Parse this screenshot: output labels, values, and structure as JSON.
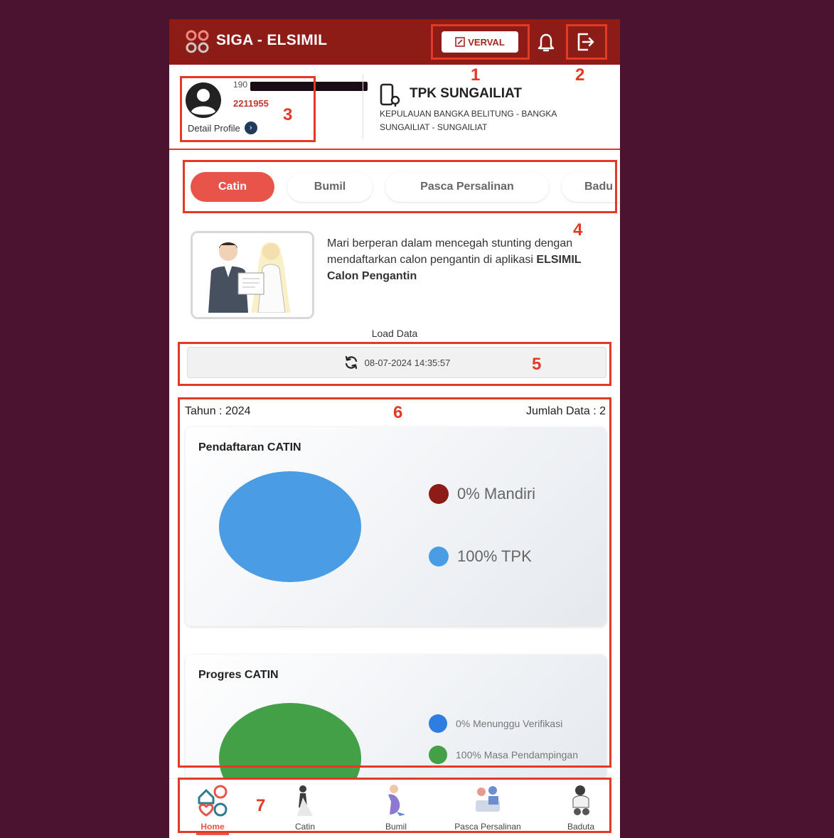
{
  "app": {
    "title": "SIGA - ELSIMIL",
    "verval_label": "VERVAL"
  },
  "profile": {
    "nik_prefix": "190",
    "kk_number": "2211955",
    "detail_label": "Detail Profile",
    "detail_arrow": "›"
  },
  "location": {
    "name": "TPK SUNGAILIAT",
    "address_line1": "KEPULAUAN BANGKA BELITUNG - BANGKA",
    "address_line2": "SUNGAILIAT - SUNGAILIAT"
  },
  "tabs": [
    {
      "label": "Catin",
      "active": true
    },
    {
      "label": "Bumil",
      "active": false
    },
    {
      "label": "Pasca Persalinan",
      "active": false
    },
    {
      "label": "Badu",
      "active": false
    }
  ],
  "banner": {
    "text_prefix": "Mari berperan dalam mencegah stunting dengan mendaftarkan calon pengantin di aplikasi ",
    "text_bold": "ELSIMIL Calon Pengantin"
  },
  "load_data": {
    "label": "Load Data",
    "timestamp": "08-07-2024 14:35:57"
  },
  "summary": {
    "year_text": "Tahun : 2024",
    "count_text": "Jumlah Data : 2"
  },
  "cards": [
    {
      "title": "Pendaftaran CATIN",
      "legend": [
        {
          "label": "0% Mandiri",
          "color": "#8e1c16"
        },
        {
          "label": "100% TPK",
          "color": "#4a9de3"
        }
      ]
    },
    {
      "title": "Progres CATIN",
      "legend": [
        {
          "label": "0% Menunggu Verifikasi",
          "color": "#2f7de1"
        },
        {
          "label": "100% Masa Pendampingan",
          "color": "#43a047"
        }
      ]
    }
  ],
  "chart_data": [
    {
      "type": "pie",
      "title": "Pendaftaran CATIN",
      "categories": [
        "Mandiri",
        "TPK"
      ],
      "values": [
        0,
        100
      ],
      "colors": [
        "#8e1c16",
        "#4a9de3"
      ],
      "legend": "right"
    },
    {
      "type": "pie",
      "title": "Progres CATIN",
      "categories": [
        "Menunggu Verifikasi",
        "Masa Pendampingan"
      ],
      "values": [
        0,
        100
      ],
      "colors": [
        "#2f7de1",
        "#43a047"
      ],
      "legend": "right"
    }
  ],
  "bottom_nav": [
    {
      "label": "Home",
      "icon": "home-icon",
      "active": true
    },
    {
      "label": "Catin",
      "icon": "bride-groom-icon",
      "active": false
    },
    {
      "label": "Bumil",
      "icon": "pregnant-icon",
      "active": false
    },
    {
      "label": "Pasca Persalinan",
      "icon": "postpartum-icon",
      "active": false
    },
    {
      "label": "Baduta",
      "icon": "baby-icon",
      "active": false
    }
  ],
  "annotations": [
    "1",
    "2",
    "3",
    "4",
    "5",
    "6",
    "7"
  ],
  "colors": {
    "brand": "#8e1c16",
    "accent": "#e8534a",
    "annotation": "#e23a24"
  }
}
